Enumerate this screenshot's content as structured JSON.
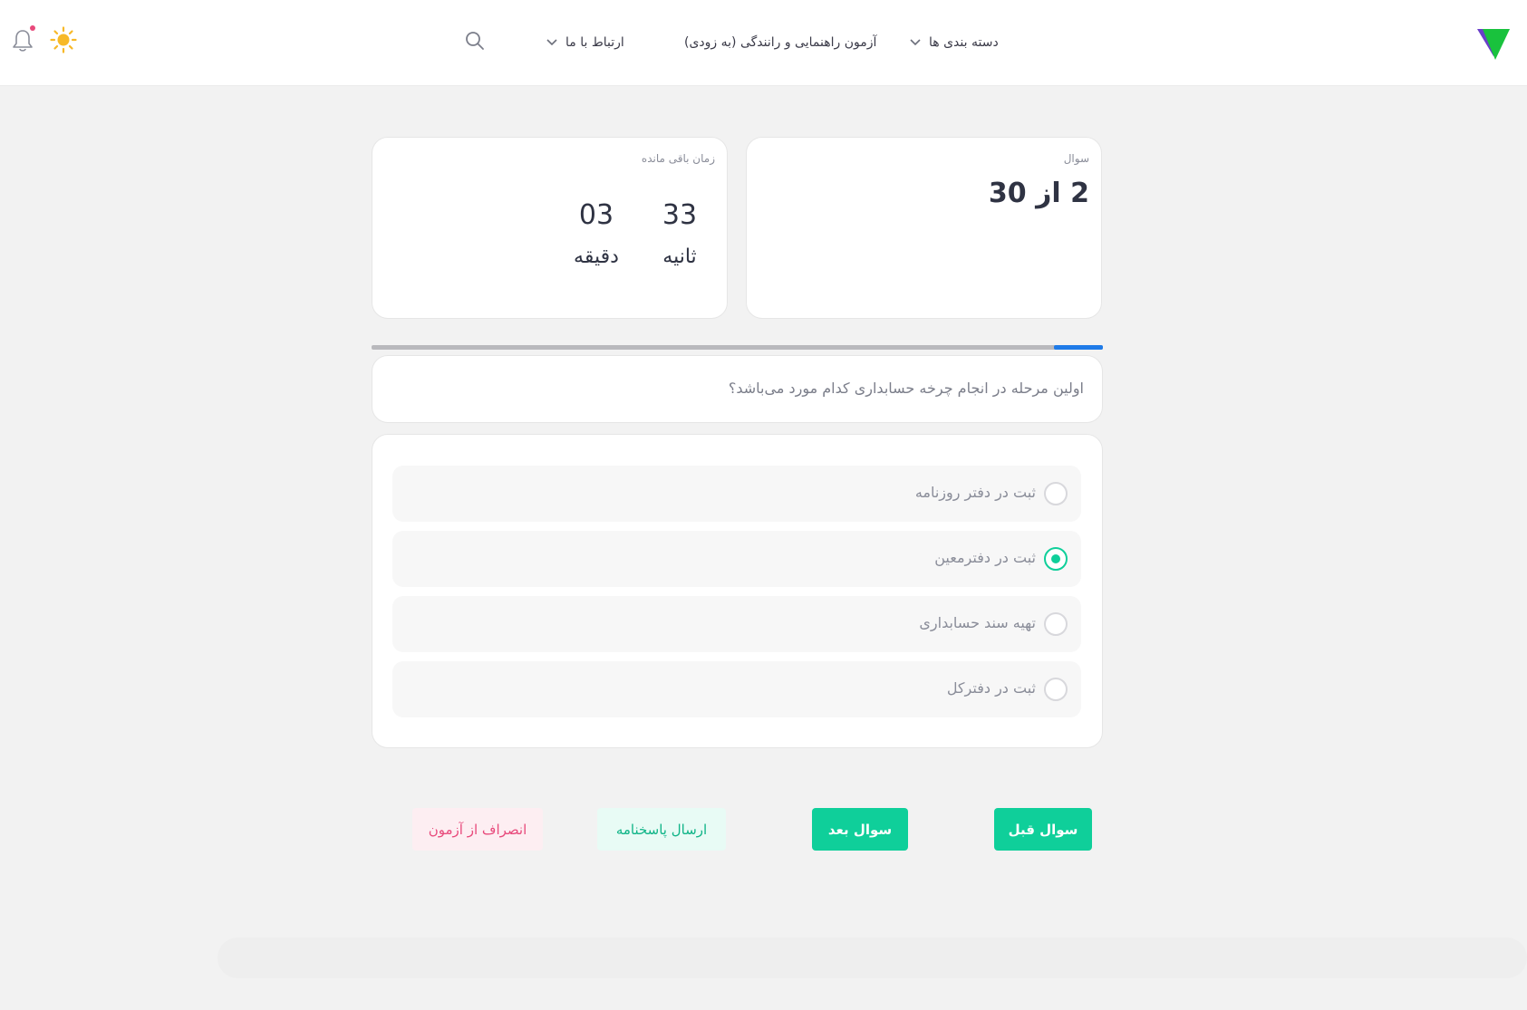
{
  "nav": {
    "categories_label": "دسته بندی ها",
    "exam_label": "آزمون راهنمایی و رانندگی (به زودی)",
    "contact_label": "ارتباط با ما"
  },
  "question_counter": {
    "label": "سوال",
    "value": "2 از 30"
  },
  "timer": {
    "label": "زمان باقی مانده",
    "seconds_value": "33",
    "seconds_unit": "ثانیه",
    "minutes_value": "03",
    "minutes_unit": "دقیقه"
  },
  "progress": {
    "fraction": 0.067,
    "track_color": "#b9b9bd",
    "fill_color": "#1f7be8"
  },
  "question": {
    "text": "اولین مرحله در انجام چرخه حسابداری کدام مورد می‌باشد؟"
  },
  "options": [
    {
      "label": "ثبت در دفتر روزنامه",
      "selected": false
    },
    {
      "label": "ثبت در دفترمعین",
      "selected": true
    },
    {
      "label": "تهیه سند حسابداری",
      "selected": false
    },
    {
      "label": "ثبت در دفترکل",
      "selected": false
    }
  ],
  "buttons": {
    "prev_label": "سوال قبل",
    "next_label": "سوال بعد",
    "submit_label": "ارسال پاسخنامه",
    "quit_label": "انصراف از آزمون"
  },
  "colors": {
    "accent": "#0fcf9a",
    "danger": "#e8497b",
    "progress": "#1f7be8"
  },
  "icons": [
    "logo-icon",
    "chevron-down-icon",
    "search-icon",
    "sun-icon",
    "bell-icon"
  ]
}
